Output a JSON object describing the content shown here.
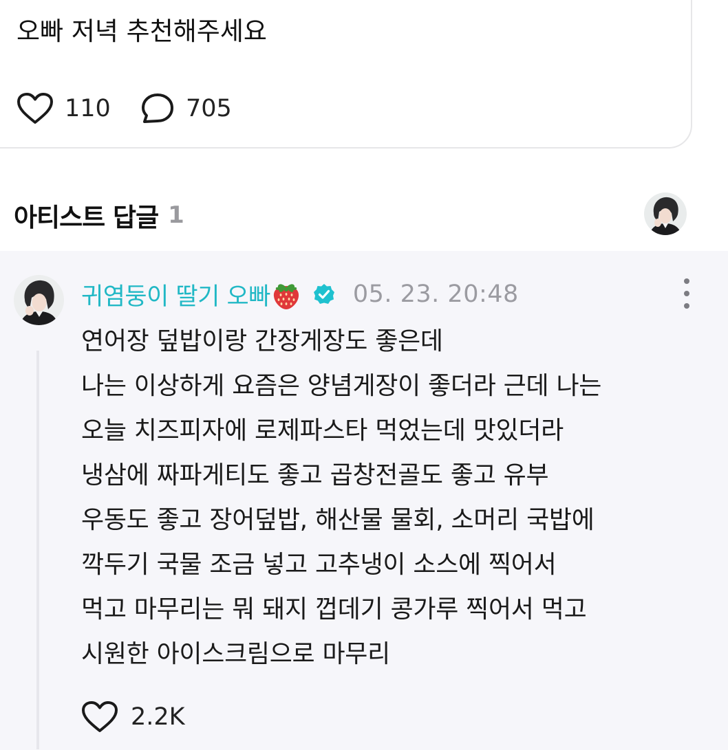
{
  "post": {
    "text": "오빠 저녁 추천해주세요",
    "likes": "110",
    "comments": "705"
  },
  "artist_replies": {
    "title": "아티스트 답글",
    "count": "1"
  },
  "reply": {
    "author": "귀염둥이 딸기 오빠",
    "verified": true,
    "timestamp": "05. 23. 20:48",
    "lines": [
      "연어장 덮밥이랑 간장게장도 좋은데",
      "나는 이상하게 요즘은 양념게장이 좋더라 근데 나는",
      "오늘 치즈피자에 로제파스타 먹었는데 맛있더라",
      "냉삼에 짜파게티도 좋고 곱창전골도 좋고 유부",
      "우동도 좋고 장어덮밥, 해산물 물회, 소머리 국밥에",
      "깍두기 국물 조금 넣고 고추냉이 소스에 찍어서",
      "먹고 마무리는 뭐 돼지 껍데기 콩가루 찍어서 먹고",
      "시원한 아이스크림으로 마무리"
    ],
    "likes": "2.2K"
  },
  "colors": {
    "author_name": "#21b8c5",
    "verified_badge": "#1fc1cf",
    "reply_background": "#f6f6fa",
    "muted_text": "#9b9ba1"
  },
  "icons": {
    "like": "heart-outline-icon",
    "comment": "speech-bubble-icon",
    "name_emoji": "strawberry-icon",
    "badge": "verified-badge-icon",
    "menu": "more-vertical-icon"
  }
}
